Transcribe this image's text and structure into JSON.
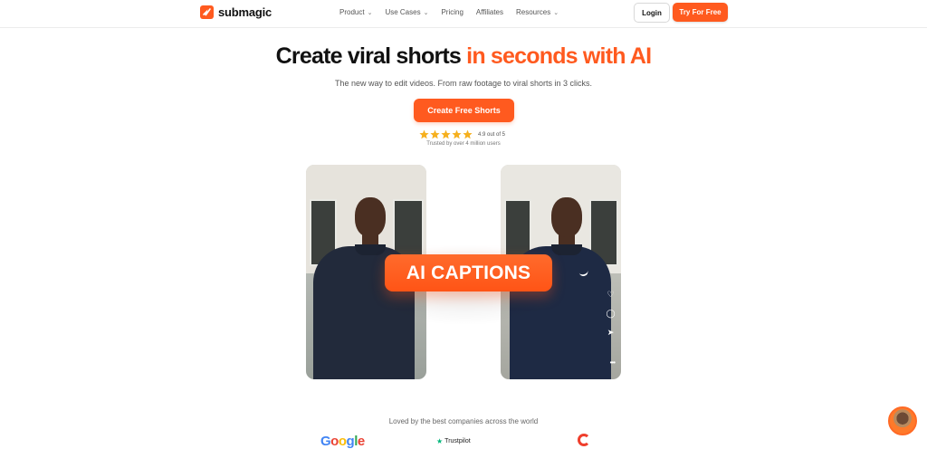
{
  "brand": {
    "name": "submagic",
    "accent": "#ff5a1f"
  },
  "nav": {
    "items": [
      {
        "label": "Product",
        "dropdown": true
      },
      {
        "label": "Use Cases",
        "dropdown": true
      },
      {
        "label": "Pricing",
        "dropdown": false
      },
      {
        "label": "Affiliates",
        "dropdown": false
      },
      {
        "label": "Resources",
        "dropdown": true
      }
    ],
    "login_label": "Login",
    "try_label": "Try For Free"
  },
  "hero": {
    "title_main": "Create viral shorts",
    "title_accent": "in seconds with AI",
    "subtitle": "The new way to edit videos. From raw footage to viral shorts in 3 clicks.",
    "cta_label": "Create Free Shorts",
    "rating_text": "4.9 out of 5",
    "rating_value": 4.9,
    "stars": 5,
    "trusted_text": "Trusted by over 4 million users"
  },
  "demo": {
    "badge_label": "AI CAPTIONS",
    "icons": [
      "heart-icon",
      "comment-icon",
      "share-icon",
      "more-icon"
    ]
  },
  "logos": {
    "heading": "Loved by the best companies across the world",
    "google": [
      "G",
      "o",
      "o",
      "g",
      "l",
      "e"
    ],
    "trustpilot": "Trustpilot"
  }
}
